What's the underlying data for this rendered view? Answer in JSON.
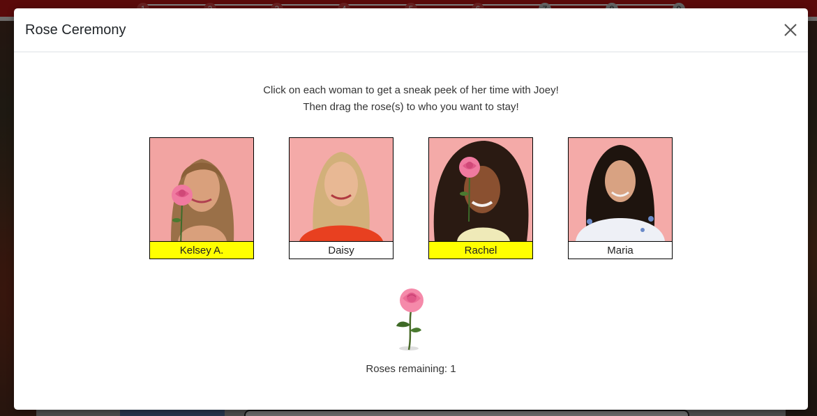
{
  "background": {
    "progress_steps": [
      "1",
      "2",
      "3",
      "4",
      "5",
      "6",
      "7",
      "8",
      "9"
    ],
    "completed_steps": 6
  },
  "modal": {
    "title": "Rose Ceremony",
    "close_icon": "close-icon",
    "instructions": [
      "Click on each woman to get a sneak peek of her time with Joey!",
      "Then drag the rose(s) to who you want to stay!"
    ],
    "contestants": [
      {
        "name": "Kelsey A.",
        "has_rose": true
      },
      {
        "name": "Daisy",
        "has_rose": false
      },
      {
        "name": "Rachel",
        "has_rose": true
      },
      {
        "name": "Maria",
        "has_rose": false
      }
    ],
    "rose_icon": "rose-icon",
    "roses_remaining": "Roses remaining: 1"
  },
  "colors": {
    "selected_highlight": "#ffff00",
    "photo_background": "#f4a6a8",
    "topbar": "#b51414"
  }
}
